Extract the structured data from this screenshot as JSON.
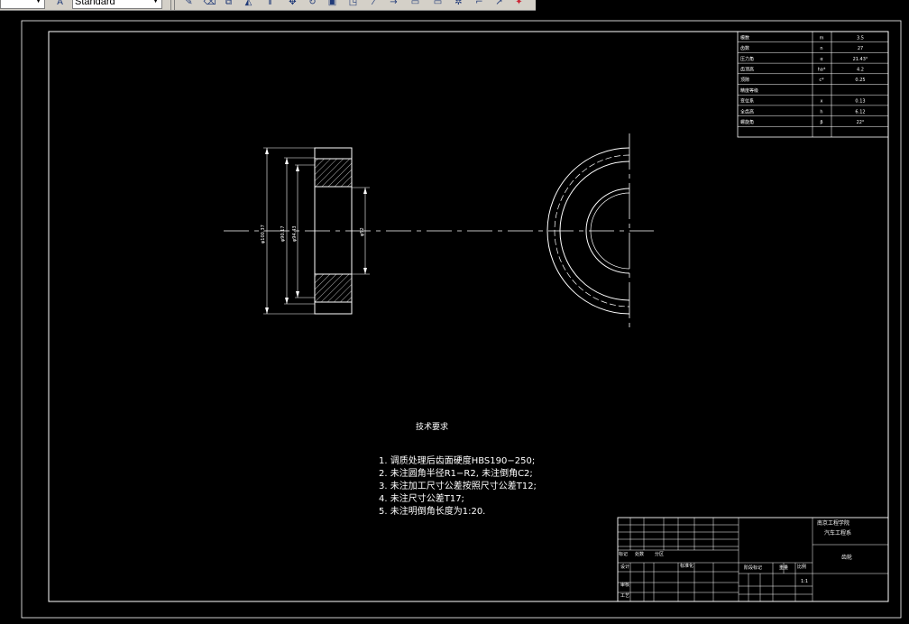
{
  "toolbar": {
    "layer_value": "",
    "style_value": "Standard"
  },
  "gear_params": [
    {
      "name": "模数",
      "symbol": "m",
      "value": "3.5"
    },
    {
      "name": "齿数",
      "symbol": "n",
      "value": "27"
    },
    {
      "name": "压力角",
      "symbol": "α",
      "value": "21.43°"
    },
    {
      "name": "齿顶高",
      "symbol": "ha*",
      "value": "4.2"
    },
    {
      "name": "顶隙",
      "symbol": "c*",
      "value": "0.25"
    },
    {
      "name": "精度等级",
      "symbol": "",
      "value": ""
    },
    {
      "name": "变位系",
      "symbol": "x",
      "value": "0.13"
    },
    {
      "name": "全齿高",
      "symbol": "h",
      "value": "6.12"
    },
    {
      "name": "螺旋角",
      "symbol": "β",
      "value": "22°"
    },
    {
      "name": "",
      "symbol": "",
      "value": ""
    }
  ],
  "dimensions": {
    "outer": "φ100.37",
    "root": "φ90.17",
    "pitch": "φ94.43",
    "bore": "φ52"
  },
  "tech_requirements": {
    "title": "技术要求",
    "items": [
      "1. 调质处理后齿面硬度HBS190−250;",
      "2. 未注圆角半径R1−R2, 未注倒角C2;",
      "3. 未注加工尺寸公差按照尺寸公差T12;",
      "4. 未注尺寸公差T17;",
      "5. 未注明倒角长度为1:20."
    ]
  },
  "title_block": {
    "school": "南京工程学院",
    "department": "汽车工程系",
    "part_name": "齿轮",
    "mark_labels": [
      "标记",
      "处数",
      "分区"
    ],
    "design_label": "设计",
    "review_label": "审核",
    "process_label": "工艺",
    "standard_label": "标准化",
    "stage_label": "阶段标记",
    "weight_label": "重量",
    "scale_label": "比例",
    "scale_value": "1:1"
  }
}
